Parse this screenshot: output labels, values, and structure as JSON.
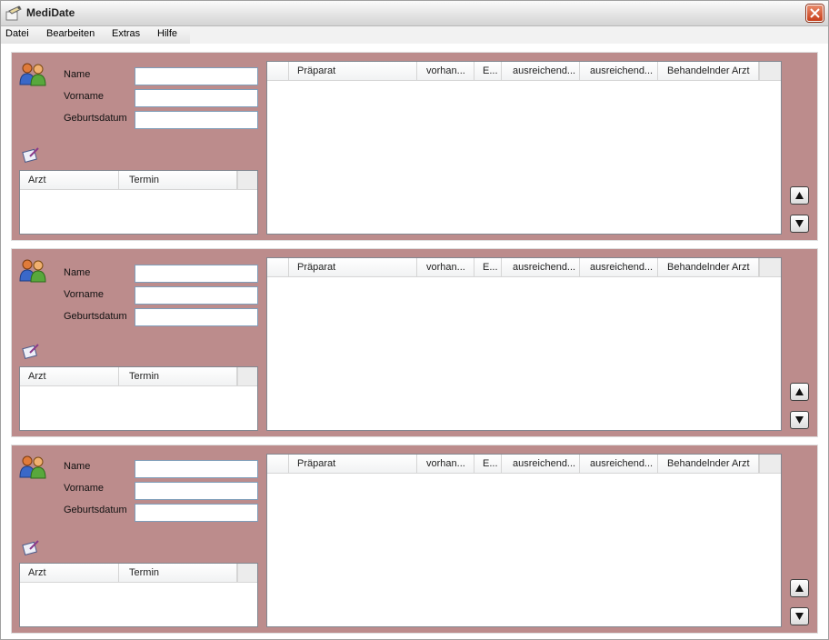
{
  "app": {
    "title": "MediDate"
  },
  "menu": [
    {
      "label": "Datei"
    },
    {
      "label": "Bearbeiten"
    },
    {
      "label": "Extras"
    },
    {
      "label": "Hilfe"
    }
  ],
  "labels": {
    "name": "Name",
    "vorname": "Vorname",
    "geburtsdatum": "Geburtsdatum"
  },
  "appointments_columns": [
    "Arzt",
    "Termin"
  ],
  "medication_columns": [
    "Präparat",
    "vorhan...",
    "E...",
    "ausreichend...",
    "ausreichend...",
    "Behandelnder Arzt"
  ],
  "patients": [
    {
      "name": "",
      "vorname": "",
      "geburtsdatum": ""
    },
    {
      "name": "",
      "vorname": "",
      "geburtsdatum": ""
    },
    {
      "name": "",
      "vorname": "",
      "geburtsdatum": ""
    }
  ],
  "colors": {
    "panel": "#bc8c8c",
    "close": "#c8401c"
  },
  "icons": {
    "app": "medidate-app-icon",
    "person": "patients-icon",
    "edit": "appointment-edit-icon",
    "up": "arrow-up-icon",
    "down": "arrow-down-icon",
    "close": "close-icon"
  }
}
